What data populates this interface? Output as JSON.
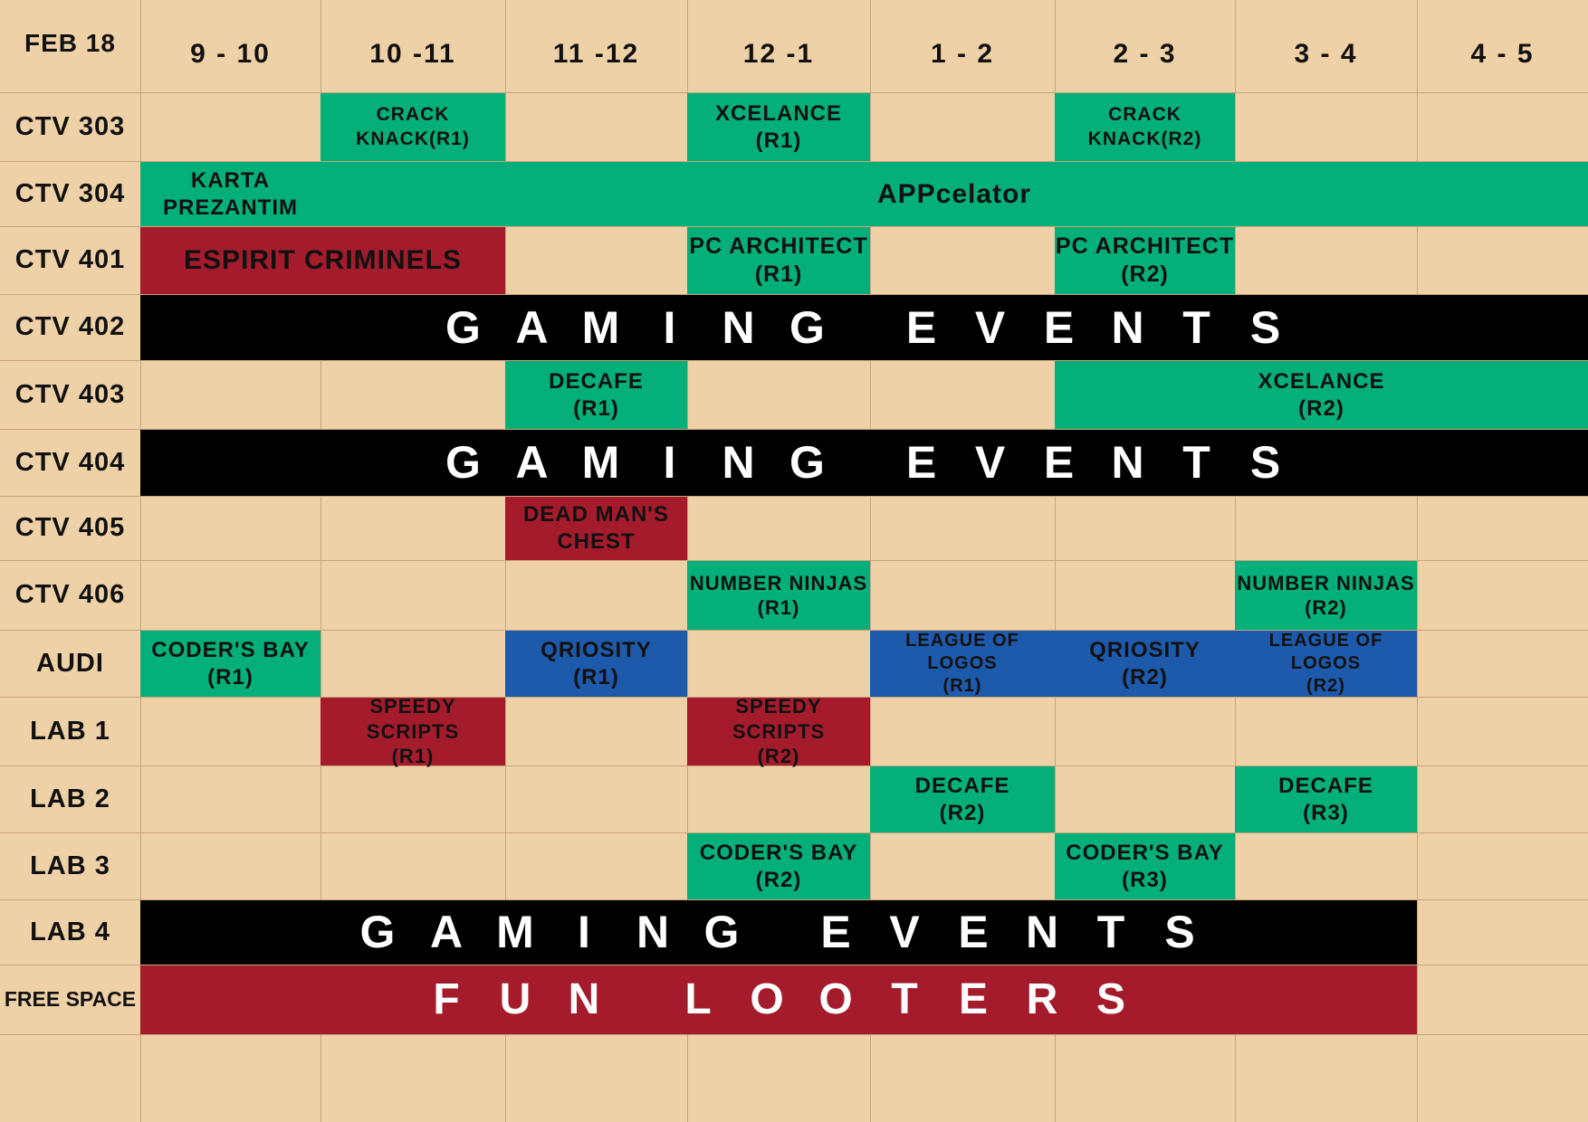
{
  "header": {
    "date": "FEB 18",
    "slots": [
      "9 - 10",
      "10 -11",
      "11 -12",
      "12 -1",
      "1 - 2",
      "2 - 3",
      "3 - 4",
      "4 - 5"
    ]
  },
  "rooms": [
    "CTV 303",
    "CTV 304",
    "CTV 401",
    "CTV 402",
    "CTV 403",
    "CTV 404",
    "CTV 405",
    "CTV 406",
    "AUDI",
    "LAB 1",
    "LAB 2",
    "LAB 3",
    "LAB 4",
    "FREE SPACE"
  ],
  "colors": {
    "background": "#EFD1A7",
    "grid": "#C9A37C",
    "green": "#04AF79",
    "red": "#A41B2C",
    "blue": "#1D5AAB",
    "black": "#000000"
  },
  "events": [
    {
      "room": "CTV 303",
      "slot": "10 -11",
      "span": 1,
      "color": "green",
      "label": "CRACK\nKNACK(R1)"
    },
    {
      "room": "CTV 303",
      "slot": "12 -1",
      "span": 1,
      "color": "green",
      "label": "XCELANCE\n(R1)"
    },
    {
      "room": "CTV 303",
      "slot": "2 - 3",
      "span": 1,
      "color": "green",
      "label": "CRACK\nKNACK(R2)"
    },
    {
      "room": "CTV 304",
      "slot": "9 - 10",
      "span": 1,
      "color": "green",
      "label": "KARTA\nPREZANTIM"
    },
    {
      "room": "CTV 304",
      "slot": "10 -11",
      "span": 7,
      "color": "green",
      "label": "APPcelator"
    },
    {
      "room": "CTV 401",
      "slot": "9 - 10",
      "span": 2,
      "color": "red",
      "label": "ESPIRIT CRIMINELS"
    },
    {
      "room": "CTV 401",
      "slot": "12 -1",
      "span": 1,
      "color": "green",
      "label": "PC ARCHITECT\n(R1)"
    },
    {
      "room": "CTV 401",
      "slot": "2 - 3",
      "span": 1,
      "color": "green",
      "label": "PC ARCHITECT\n(R2)"
    },
    {
      "room": "CTV 402",
      "slot": "9 - 10",
      "span": 8,
      "color": "black",
      "label": "GAMING EVENTS"
    },
    {
      "room": "CTV 403",
      "slot": "11 -12",
      "span": 1,
      "color": "green",
      "label": "DECAFE\n(R1)"
    },
    {
      "room": "CTV 403",
      "slot": "2 - 3",
      "span": 3,
      "color": "green",
      "label": "XCELANCE\n(R2)"
    },
    {
      "room": "CTV 404",
      "slot": "9 - 10",
      "span": 8,
      "color": "black",
      "label": "GAMING EVENTS"
    },
    {
      "room": "CTV 405",
      "slot": "11 -12",
      "span": 1,
      "color": "red",
      "label": "DEAD MAN'S\nCHEST"
    },
    {
      "room": "CTV 406",
      "slot": "12 -1",
      "span": 1,
      "color": "green",
      "label": "NUMBER NINJAS\n(R1)"
    },
    {
      "room": "CTV 406",
      "slot": "3 - 4",
      "span": 1,
      "color": "green",
      "label": "NUMBER NINJAS\n(R2)"
    },
    {
      "room": "AUDI",
      "slot": "9 - 10",
      "span": 1,
      "color": "green",
      "label": "CODER'S BAY\n(R1)"
    },
    {
      "room": "AUDI",
      "slot": "11 -12",
      "span": 1,
      "color": "blue",
      "label": "QRIOSITY\n(R1)"
    },
    {
      "room": "AUDI",
      "slot": "1 - 2",
      "span": 1,
      "color": "blue",
      "label": "LEAGUE OF LOGOS\n(R1)"
    },
    {
      "room": "AUDI",
      "slot": "2 - 3",
      "span": 1,
      "color": "blue",
      "label": "QRIOSITY\n(R2)"
    },
    {
      "room": "AUDI",
      "slot": "3 - 4",
      "span": 1,
      "color": "blue",
      "label": "LEAGUE OF LOGOS\n(R2)"
    },
    {
      "room": "LAB 1",
      "slot": "10 -11",
      "span": 1,
      "color": "red",
      "label": "SPEEDY SCRIPTS\n(R1)"
    },
    {
      "room": "LAB 1",
      "slot": "12 -1",
      "span": 1,
      "color": "red",
      "label": "SPEEDY SCRIPTS\n(R2)"
    },
    {
      "room": "LAB 2",
      "slot": "1 - 2",
      "span": 1,
      "color": "green",
      "label": "DECAFE\n(R2)"
    },
    {
      "room": "LAB 2",
      "slot": "3 - 4",
      "span": 1,
      "color": "green",
      "label": "DECAFE\n(R3)"
    },
    {
      "room": "LAB 3",
      "slot": "12 -1",
      "span": 1,
      "color": "green",
      "label": "CODER'S BAY\n(R2)"
    },
    {
      "room": "LAB 3",
      "slot": "2 - 3",
      "span": 1,
      "color": "green",
      "label": "CODER'S BAY\n(R3)"
    },
    {
      "room": "LAB 4",
      "slot": "9 - 10",
      "span": 7,
      "color": "black",
      "label": "GAMING EVENTS"
    },
    {
      "room": "FREE SPACE",
      "slot": "9 - 10",
      "span": 7,
      "color": "red",
      "label": "FUN LOOTERS"
    }
  ]
}
